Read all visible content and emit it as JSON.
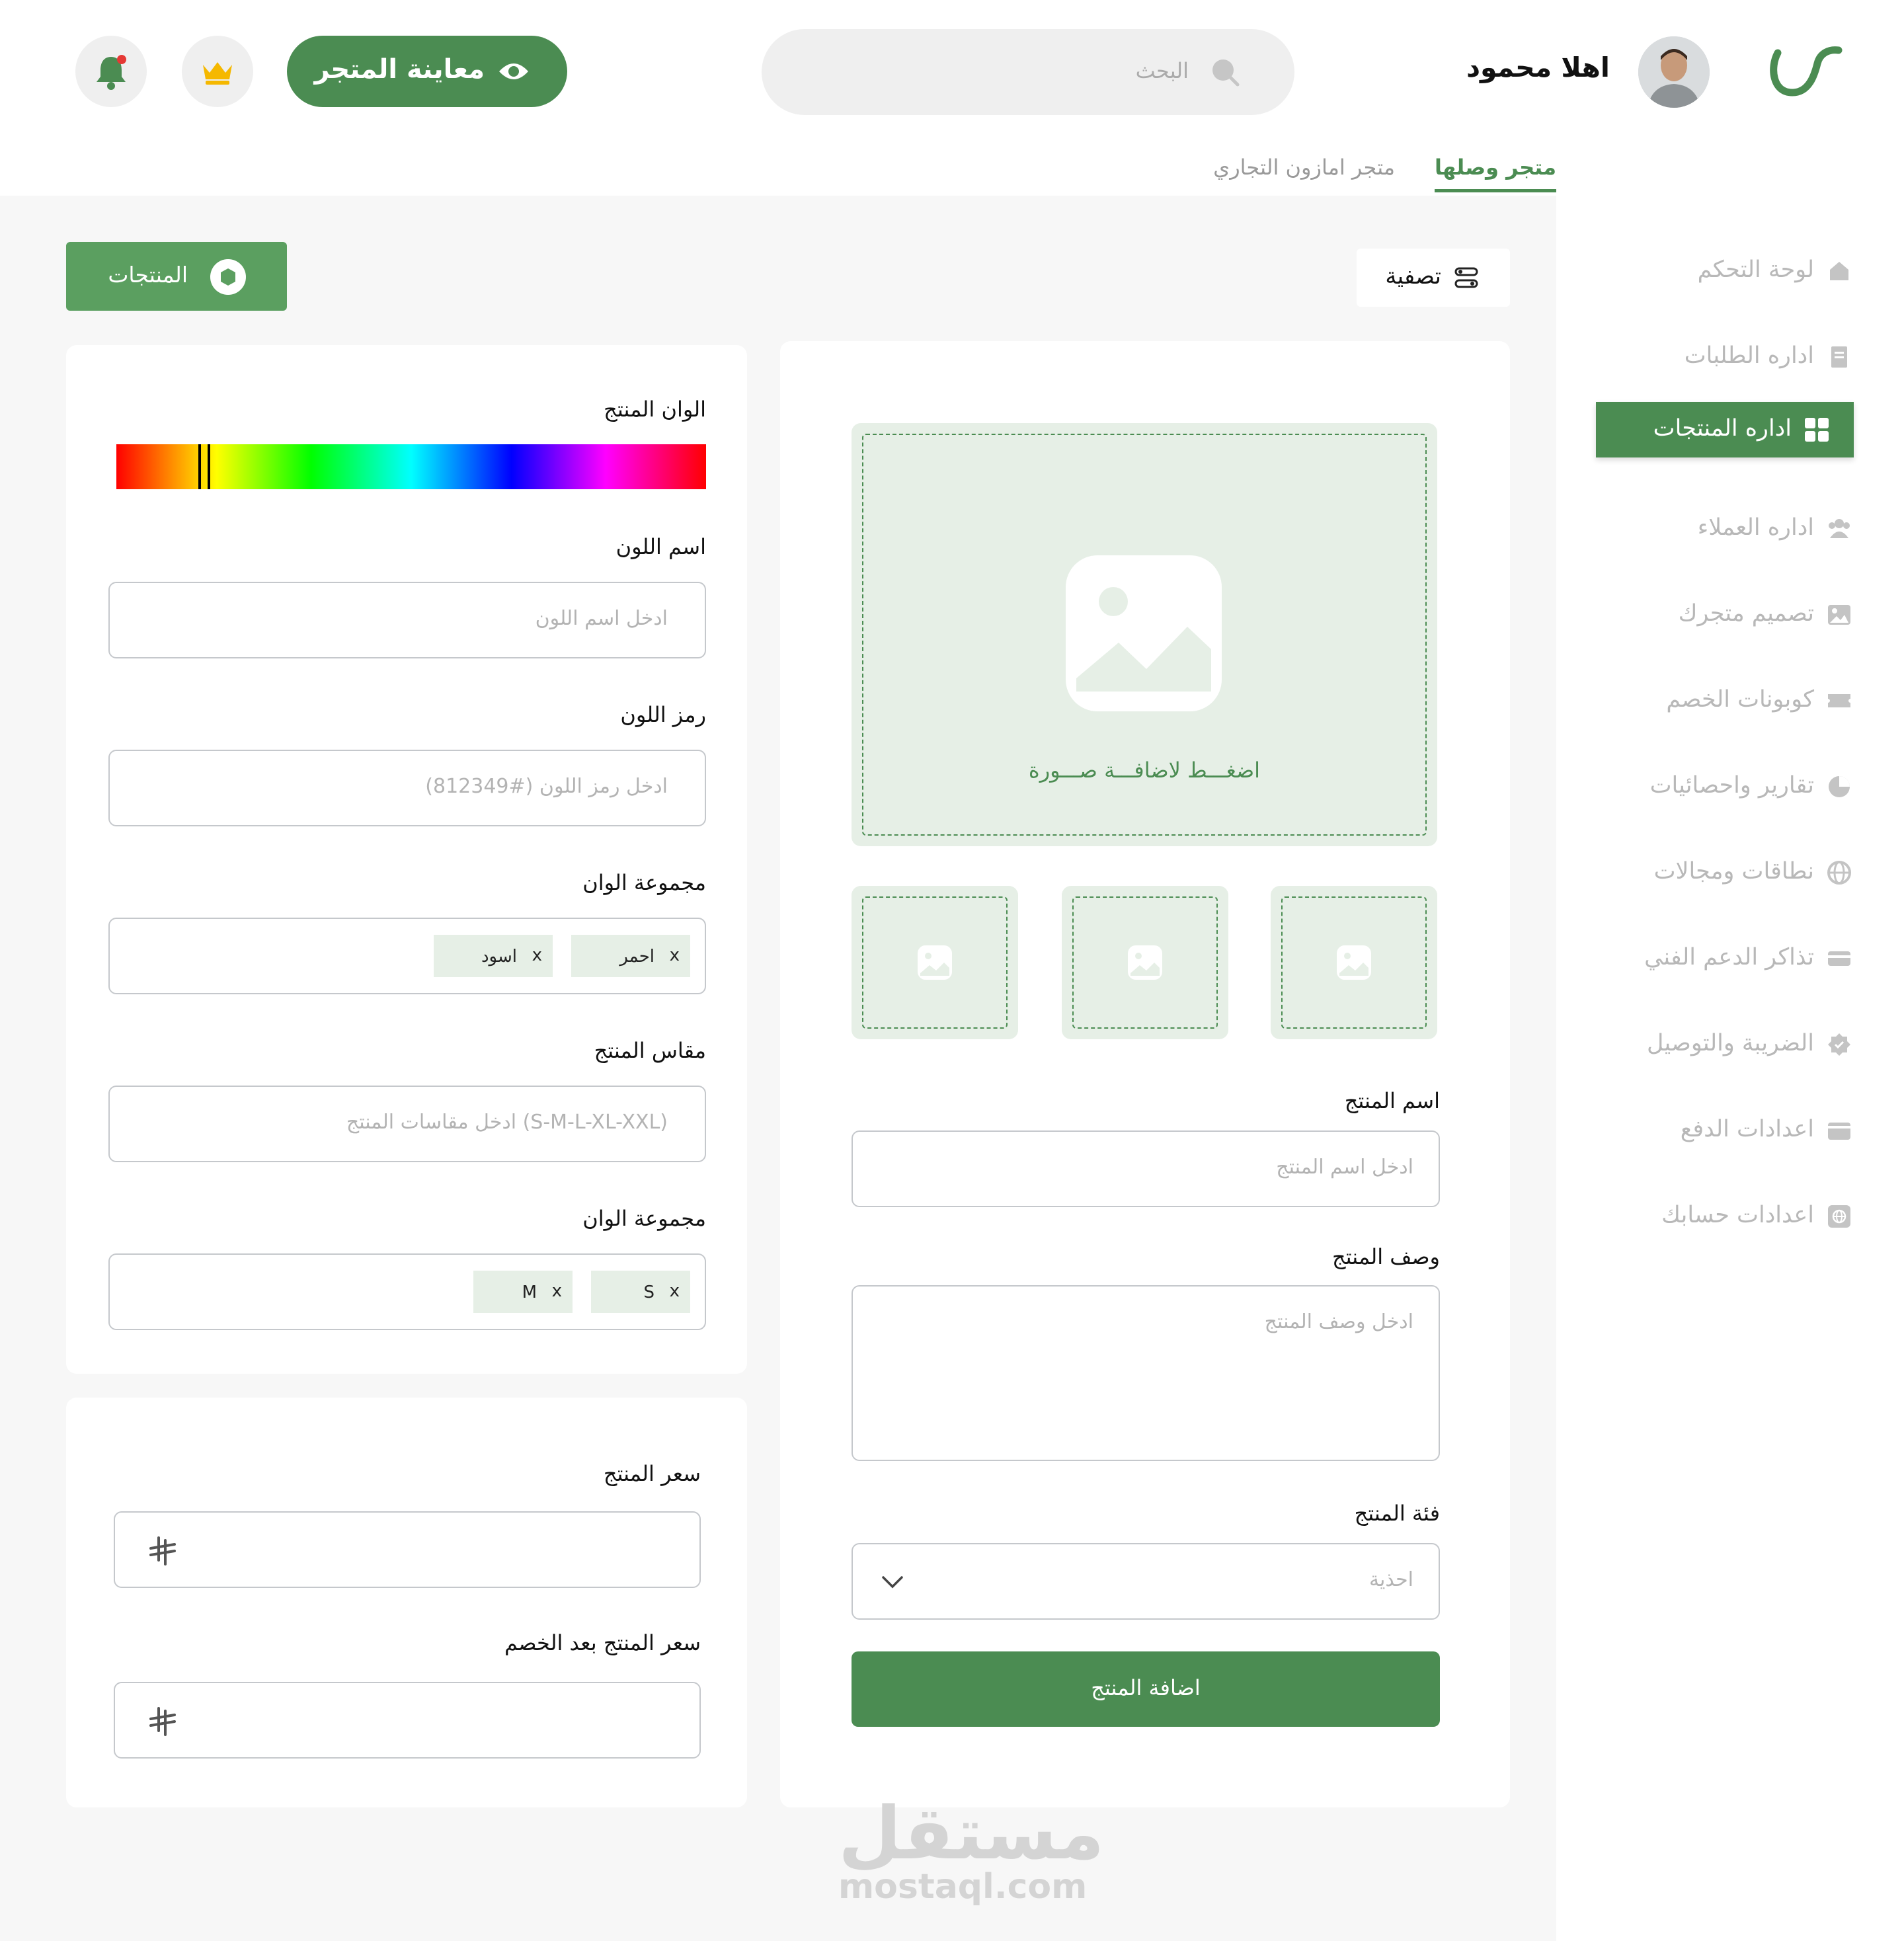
{
  "header": {
    "greeting": "اهلا محمود",
    "search_placeholder": "البحث",
    "preview_button": "معاينة المتجر",
    "store_tabs": [
      "متجر وصلها",
      "متجر امازون التجاري"
    ]
  },
  "sidebar": {
    "items": [
      {
        "label": "لوحة التحكم",
        "icon": "home-icon"
      },
      {
        "label": "اداره الطلبات",
        "icon": "orders-icon"
      },
      {
        "label": "اداره المنتجات",
        "icon": "grid-icon",
        "active": true
      },
      {
        "label": "اداره العملاء",
        "icon": "customers-icon"
      },
      {
        "label": "تصميم متجرك",
        "icon": "image-icon"
      },
      {
        "label": "كوبونات الخصم",
        "icon": "coupon-icon"
      },
      {
        "label": "تقارير واحصائيات",
        "icon": "pie-chart-icon"
      },
      {
        "label": "نطاقات ومجالات",
        "icon": "globe-icon"
      },
      {
        "label": "تذاكر الدعم الفني",
        "icon": "ticket-icon"
      },
      {
        "label": "الضريبة والتوصيل",
        "icon": "badge-icon"
      },
      {
        "label": "اعدادات الدفع",
        "icon": "wallet-icon"
      },
      {
        "label": "اعدادات حسابك",
        "icon": "settings-globe-icon"
      }
    ]
  },
  "toolbar": {
    "products_button": "المنتجات",
    "filter_button": "تصفية"
  },
  "color_card": {
    "colors_label": "الوان المنتج",
    "color_name_label": "اسم اللون",
    "color_name_placeholder": "ادخل اسم اللون",
    "color_code_label": "رمز اللون",
    "color_code_placeholder": "ادخل رمز اللون (#812349)",
    "colors_group_label": "مجموعة الوان",
    "color_chips": [
      "احمر",
      "اسود"
    ],
    "size_label": "مقاس المنتج",
    "size_placeholder": "ادخل مقاسات المنتج (S-M-L-XL-XXL)",
    "sizes_group_label": "مجموعة الوان",
    "size_chips": [
      "S",
      "M"
    ],
    "chip_remove": "x"
  },
  "price_card": {
    "price_label": "سعر المنتج",
    "discount_price_label": "سعر المنتج بعد الخصم"
  },
  "product_card": {
    "upload_text": "اضغـــط لاضافـــة صـــورة",
    "name_label": "اسم المنتج",
    "name_placeholder": "ادخل اسم المنتج",
    "description_label": "وصف المنتج",
    "description_placeholder": "ادخل وصف المنتج",
    "category_label": "فئة المنتج",
    "category_value": "احذية",
    "submit_button": "اضافة المنتج"
  },
  "watermark": {
    "arabic": "مستقل",
    "url": "mostaql.com"
  },
  "colors": {
    "brand_green": "#4b8c52",
    "light_green": "#e6efe6",
    "notification_dot": "#e53935",
    "crown": "#f5b800"
  }
}
